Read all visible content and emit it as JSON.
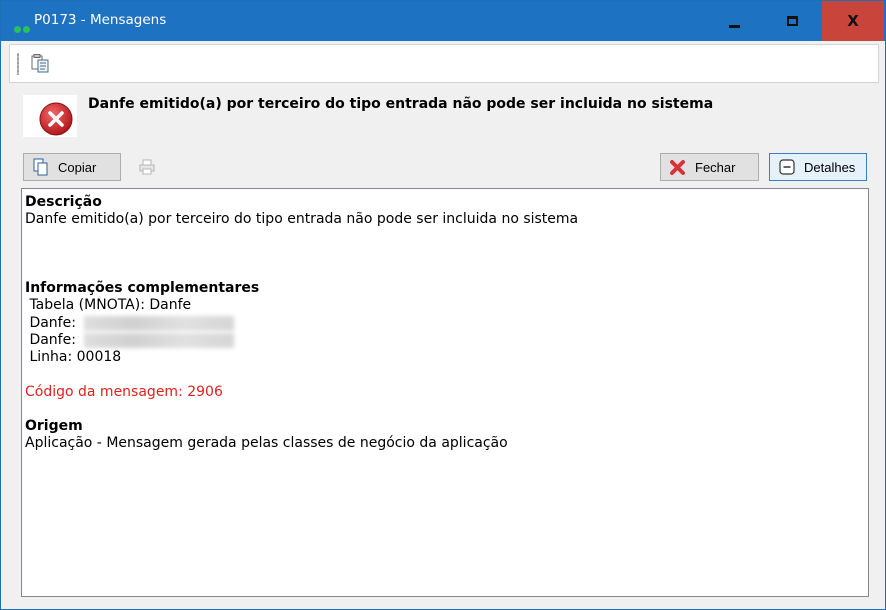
{
  "window": {
    "title": "P0173 - Mensagens",
    "title_bar_color": "#1e72c2",
    "close_button_color": "#c9453b"
  },
  "toolbar": {
    "icon": "paste-document-icon"
  },
  "error": {
    "icon": "error-x-icon",
    "title": "Danfe emitido(a) por terceiro do tipo entrada não pode ser incluida no sistema"
  },
  "buttons": {
    "copiar": "Copiar",
    "fechar": "Fechar",
    "detalhes": "Detalhes"
  },
  "panel": {
    "descricao_header": "Descrição",
    "descricao_text": "Danfe emitido(a) por terceiro do tipo entrada não pode ser incluida no sistema",
    "info_header": "Informações complementares",
    "info_lines": [
      " Tabela (MNOTA): Danfe",
      " Danfe:",
      " Danfe:",
      " Linha: 00018"
    ],
    "codigo": "Código da mensagem: 2906",
    "codigo_color": "#e02020",
    "origem_header": "Origem",
    "origem_text": "Aplicação - Mensagem gerada pelas classes de negócio da aplicação"
  }
}
